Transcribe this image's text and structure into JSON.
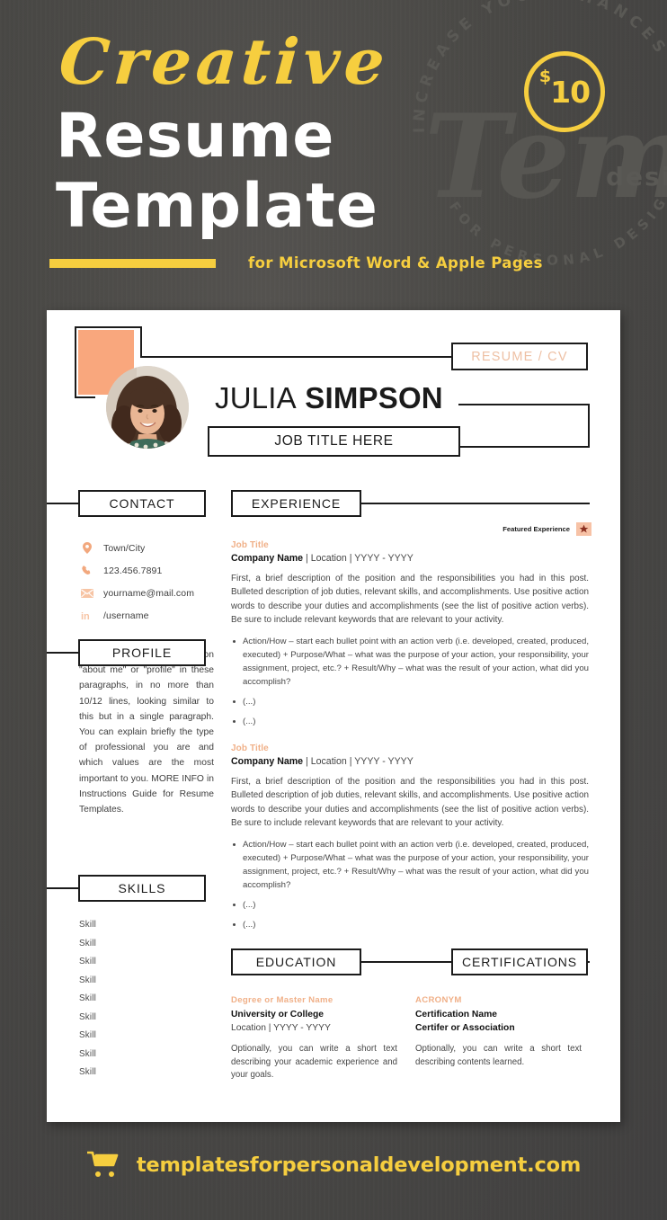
{
  "header": {
    "line1": "Creative",
    "line2": "Resume",
    "line3": "Template",
    "subtitle": "for Microsoft Word & Apple Pages",
    "price_currency": "$",
    "price_amount": "10",
    "watermark_top": "INCREASE YOUR CHANCES",
    "watermark_bottom": "FOR PERSONAL DESIGN",
    "watermark_script": "Templa",
    "watermark_sub": "design"
  },
  "colors": {
    "yellow": "#F6CE3F",
    "peach": "#F9A77D",
    "peach_light": "#F0B088",
    "dark_bg": "#4A4946",
    "ink": "#1B1B1B",
    "white": "#FFFFFF"
  },
  "resume": {
    "badge_label": "RESUME / CV",
    "first_name": "JULIA",
    "last_name": "SIMPSON",
    "job_title": "JOB TITLE HERE",
    "sections": {
      "contact": "CONTACT",
      "profile": "PROFILE",
      "skills": "SKILLS",
      "experience": "EXPERIENCE",
      "education": "EDUCATION",
      "certifications": "CERTIFICATIONS"
    },
    "contact_items": [
      {
        "icon": "location-pin-icon",
        "text": "Town/City"
      },
      {
        "icon": "phone-icon",
        "text": "123.456.7891"
      },
      {
        "icon": "envelope-icon",
        "text": "yourname@mail.com"
      },
      {
        "icon": "linkedin-icon",
        "text": "/username"
      }
    ],
    "profile_text": "You can include the section \"about me\" or \"profile\" in these paragraphs, in no more than 10/12 lines, looking similar to this but in a single paragraph. You can explain briefly the type of professional you are and which values are the most important to you. MORE INFO in Instructions Guide for Resume Templates.",
    "skills": [
      "Skill",
      "Skill",
      "Skill",
      "Skill",
      "Skill",
      "Skill",
      "Skill",
      "Skill",
      "Skill"
    ],
    "featured_label": "Featured Experience",
    "experience": [
      {
        "job_title": "Job Title",
        "company": "Company Name",
        "meta": " | Location | YYYY - YYYY",
        "paragraph": "First, a brief description of the position and the responsibilities you had in this post. Bulleted description of job duties, relevant skills, and accomplishments. Use positive action words to describe your duties and accomplishments (see the list of positive action verbs). Be sure to include relevant keywords that are relevant to your activity.",
        "bullets": [
          "Action/How – start each bullet point with an action verb (i.e. developed, created, produced, executed) + Purpose/What – what was the purpose of your action, your responsibility, your assignment, project, etc.? + Result/Why – what was the result of your action, what did you accomplish?",
          "(...)",
          "(...)"
        ]
      },
      {
        "job_title": "Job Title",
        "company": "Company Name",
        "meta": " | Location | YYYY - YYYY",
        "paragraph": "First, a brief description of the position and the responsibilities you had in this post. Bulleted description of job duties, relevant skills, and accomplishments. Use positive action words to describe your duties and accomplishments (see the list of positive action verbs). Be sure to include relevant keywords that are relevant to your activity.",
        "bullets": [
          "Action/How – start each bullet point with an action verb (i.e. developed, created, produced, executed) + Purpose/What – what was the purpose of your action, your responsibility, your assignment, project, etc.? + Result/Why – what was the result of your action, what did you accomplish?",
          "(...)",
          "(...)"
        ]
      }
    ],
    "education": {
      "tag": "Degree or Master Name",
      "institution": "University or College",
      "meta": "Location | YYYY - YYYY",
      "description": "Optionally, you can write a short text describing your academic experience and your goals."
    },
    "certifications": {
      "tag": "ACRONYM",
      "name": "Certification Name",
      "issuer": "Certifer or Association",
      "description": "Optionally, you can write a short text describing contents learned."
    }
  },
  "footer": {
    "url": "templatesforpersonaldevelopment.com",
    "icon": "shopping-cart-icon"
  }
}
